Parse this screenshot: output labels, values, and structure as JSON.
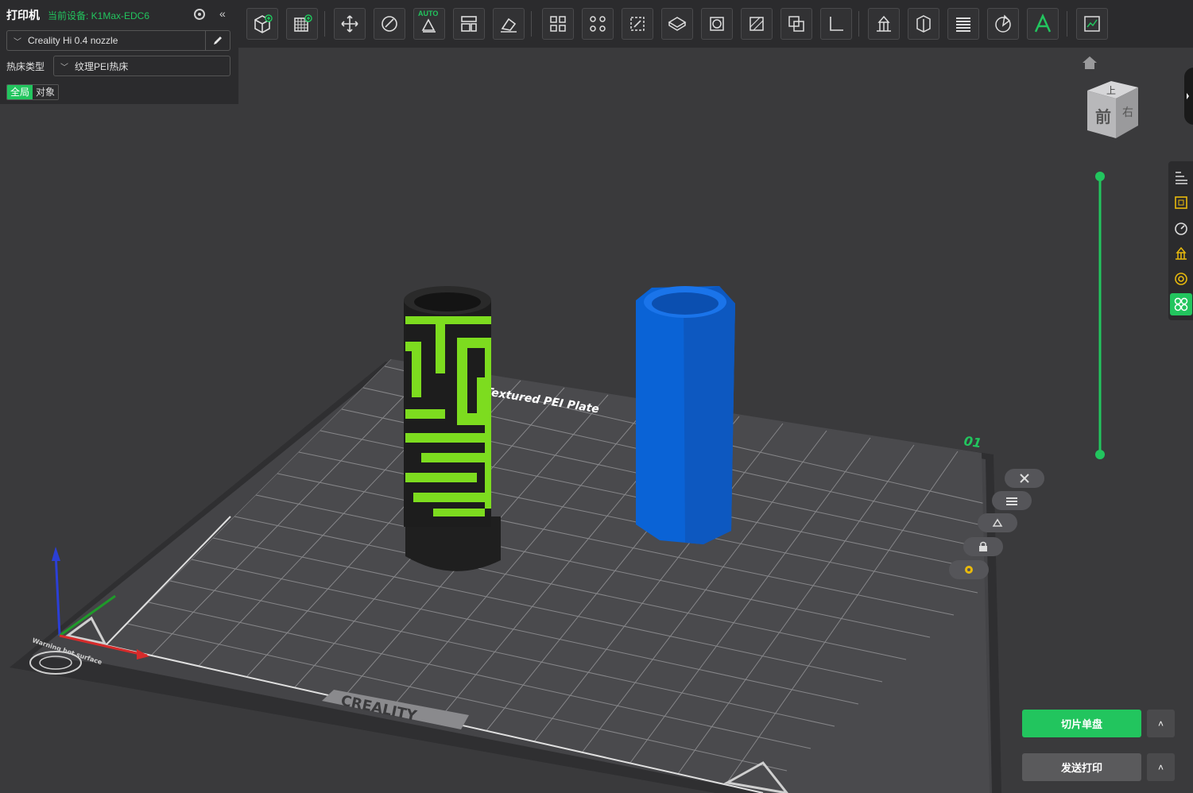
{
  "printer": {
    "title": "打印机",
    "device_label": "当前设备: K1Max-EDC6",
    "nozzle": "Creality Hi 0.4 nozzle",
    "bed_type_label": "热床类型",
    "bed_type": "纹理PEI热床"
  },
  "tabs": [
    {
      "label": "全局",
      "active": true
    },
    {
      "label": "对象",
      "active": false
    }
  ],
  "toolbar": {
    "auto_tag": "AUTO",
    "buttons": [
      "add-object",
      "add-plate",
      "auto-orient",
      "arrange",
      "auto-arrange",
      "split",
      "cut",
      "layout-grid",
      "layout-scatter",
      "scale",
      "flatten",
      "hollow",
      "slope",
      "boolean",
      "measure",
      "support-paint",
      "seam-paint",
      "layer-height",
      "color-paint",
      "text",
      "assembly"
    ]
  },
  "plate": {
    "label": "Textured PEI Plate",
    "number": "01",
    "brand": "CREALITY",
    "warning": "Warning hot surface"
  },
  "viewcube": {
    "top": "上",
    "front": "前",
    "right": "右"
  },
  "actions": {
    "slice": "切片单盘",
    "send": "发送打印",
    "more": "˄"
  },
  "colors": {
    "accent": "#22c55e",
    "object_blue": "#0a63d6",
    "object_green": "#7ddc1f",
    "object_black": "#1d1d1d"
  }
}
